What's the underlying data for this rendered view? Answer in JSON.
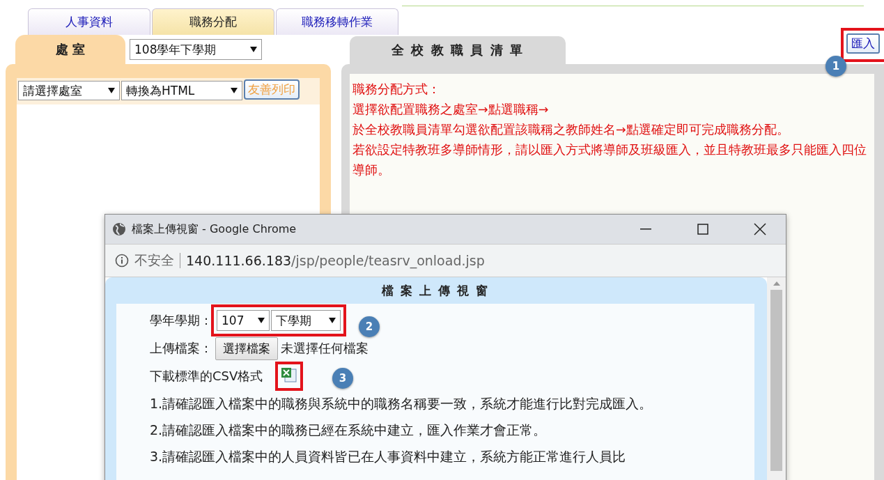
{
  "tabs": [
    {
      "label": "人事資料",
      "selected": false
    },
    {
      "label": "職務分配",
      "selected": true
    },
    {
      "label": "職務移轉作業",
      "selected": false
    }
  ],
  "office_panel": {
    "tab": "處 室",
    "term_select": "108學年下學期",
    "office_select": "請選擇處室",
    "format_select": "轉換為HTML",
    "print_button": "友善列印"
  },
  "staff_panel": {
    "tab": "全 校 教 職 員 清 單",
    "import_button": "匯入",
    "instructions": [
      "職務分配方式：",
      "選擇欲配置職務之處室→點選職稱→",
      "於全校教職員清單勾選欲配置該職稱之教師姓名→點選確定即可完成職務分配。",
      "若欲設定特教班多導師情形，請以匯入方式將導師及班級匯入，並且特教班最多只能匯入四位導師。"
    ]
  },
  "callouts": [
    {
      "number": "1"
    },
    {
      "number": "2"
    },
    {
      "number": "3"
    }
  ],
  "popup": {
    "window_title": "檔案上傳視窗 - Google Chrome",
    "security": "不安全",
    "url_host": "140.111.66.183",
    "url_path": "/jsp/people/teasrv_onload.jsp",
    "heading": "檔 案 上 傳 視 窗",
    "term_label": "學年學期：",
    "year_select": "107",
    "semester_select": "下學期",
    "upload_label": "上傳檔案：",
    "choose_button": "選擇檔案",
    "no_file": "未選擇任何檔案",
    "csv_label": "下載標準的CSV格式",
    "notes": [
      "1.請確認匯入檔案中的職務與系統中的職務名稱要一致，系統才能進行比對完成匯入。",
      "2.請確認匯入檔案中的職務已經在系統中建立，匯入作業才會正常。",
      "3.請確認匯入檔案中的人員資料皆已在人事資料中建立，系統方能正常進行人員比"
    ]
  }
}
